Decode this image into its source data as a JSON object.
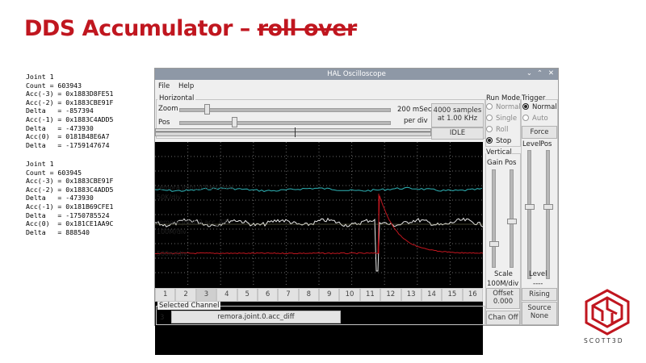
{
  "slide": {
    "title_main": "DDS Accumulator – ",
    "title_struck": "roll over"
  },
  "dump1": [
    "Joint 1",
    "Count = 603943",
    "Acc(-3) = 0x1883D8FE51",
    "Acc(-2) = 0x1883CBE91F",
    "Delta   = -857394",
    "Acc(-1) = 0x1883C4ADD5",
    "Delta   = -473930",
    "Acc(0)  = 0181B48E6A7",
    "Delta   = -1759147674"
  ],
  "dump2": [
    "Joint 1",
    "Count = 603945",
    "Acc(-3) = 0x1883CBE91F",
    "Acc(-2) = 0x1883C4ADD5",
    "Delta   = -473930",
    "Acc(-1) = 0x181B69CFE1",
    "Delta   = -1750785524",
    "Acc(0)  = 0x181CE1AA9C",
    "Delta   = 888540"
  ],
  "window": {
    "title": "HAL Oscilloscope",
    "controls": [
      "⌄",
      "⌃",
      "✕"
    ],
    "menu": [
      "File",
      "Help"
    ]
  },
  "horizontal": {
    "group_label": "Horizontal",
    "zoom_label": "Zoom",
    "pos_label": "Pos",
    "rate_line1": "200 mSec",
    "rate_line2": "per div",
    "samples_line1": "4000 samples",
    "samples_line2": "at 1.00 KHz",
    "status": "IDLE",
    "zoom_level": 0.12,
    "pos_level": 0.25
  },
  "run_mode": {
    "group_label": "Run Mode",
    "options": [
      {
        "label": "Normal",
        "selected": false
      },
      {
        "label": "Single",
        "selected": false
      },
      {
        "label": "Roll",
        "selected": false
      },
      {
        "label": "Stop",
        "selected": true
      }
    ]
  },
  "trigger": {
    "group_label": "Trigger",
    "options": [
      {
        "label": "Normal",
        "selected": true
      },
      {
        "label": "Auto",
        "selected": false
      }
    ],
    "force_label": "Force",
    "level_label": "Level",
    "pos_label": "Pos",
    "level_caption": "Level",
    "level_value": "----",
    "edge_label": "Rising",
    "source_label": "Source",
    "source_value": "None"
  },
  "vertical": {
    "group_label": "Vertical",
    "gain_label": "Gain",
    "pos_label": "Pos",
    "scale_label": "Scale",
    "scale_value": "100M/div",
    "offset_label": "Offset",
    "offset_value": "0.000",
    "chan_off_label": "Chan Off"
  },
  "channels": {
    "tabs": [
      "1",
      "2",
      "3",
      "4",
      "5",
      "6",
      "7",
      "8",
      "9",
      "10",
      "11",
      "12",
      "13",
      "14",
      "15",
      "16"
    ],
    "selected_index": 2,
    "selected_label": "Selected Channel",
    "selected_number": "3",
    "selected_name": "remora.joint.0.acc_diff"
  },
  "scope_traces": [
    {
      "name": "remora.joint.0.freq-cmd",
      "scale": "50K/div",
      "color": "#2fb5b8"
    },
    {
      "name": "remora.joint.0.acc_diff",
      "scale": "100M/div",
      "color": "#e8e8e8"
    },
    {
      "name": "",
      "scale": "500m/div",
      "color": "#c0161f"
    }
  ],
  "logo": {
    "text": "SCOTT3D",
    "color": "#c0161f"
  }
}
